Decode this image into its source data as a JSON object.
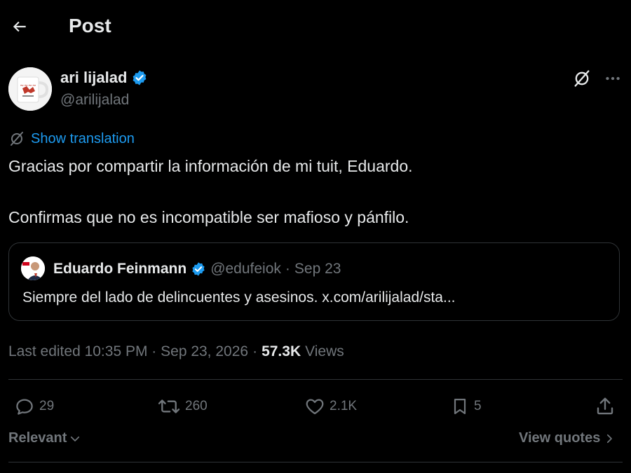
{
  "header": {
    "title": "Post",
    "back_icon": "arrow-left-icon"
  },
  "author": {
    "name": "ari lijalad",
    "handle": "@arilijalad",
    "verified": true,
    "verified_color": "#1d9bf0"
  },
  "translation": {
    "label": "Show translation"
  },
  "post": {
    "line1": "Gracias por compartir la información de mi tuit, Eduardo.",
    "line2": "Confirmas que no es incompatible ser mafioso y pánfilo."
  },
  "quote": {
    "name": "Eduardo Feinmann",
    "handle": "@edufeiok",
    "separator": "·",
    "date": "Sep 23",
    "text": "Siempre del lado de delincuentes y asesinos. x.com/arilijalad/sta..."
  },
  "meta": {
    "edited": "Last edited 10:35 PM · Sep 23, 2026",
    "dot": "·",
    "views_count": "57.3K",
    "views_label": "Views"
  },
  "actions": {
    "replies": "29",
    "reposts": "260",
    "likes": "2.1K",
    "bookmarks": "5"
  },
  "footer": {
    "sort_label": "Relevant",
    "view_quotes": "View quotes"
  },
  "colors": {
    "background": "#000000",
    "text": "#e7e9ea",
    "muted": "#71767b",
    "accent": "#1d9bf0",
    "border": "#2f3336"
  }
}
